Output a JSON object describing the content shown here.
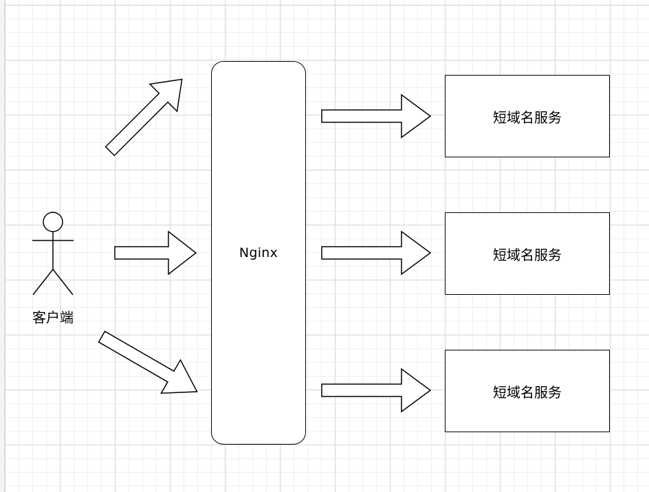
{
  "diagram": {
    "actor": {
      "label": "客户端",
      "icon": "person-icon"
    },
    "proxy": {
      "label": "Nginx"
    },
    "services": [
      {
        "label": "短域名服务"
      },
      {
        "label": "短域名服务"
      },
      {
        "label": "短域名服务"
      }
    ],
    "colors": {
      "stroke": "#000000",
      "fill": "#ffffff",
      "grid": "#d4d4d4"
    }
  }
}
